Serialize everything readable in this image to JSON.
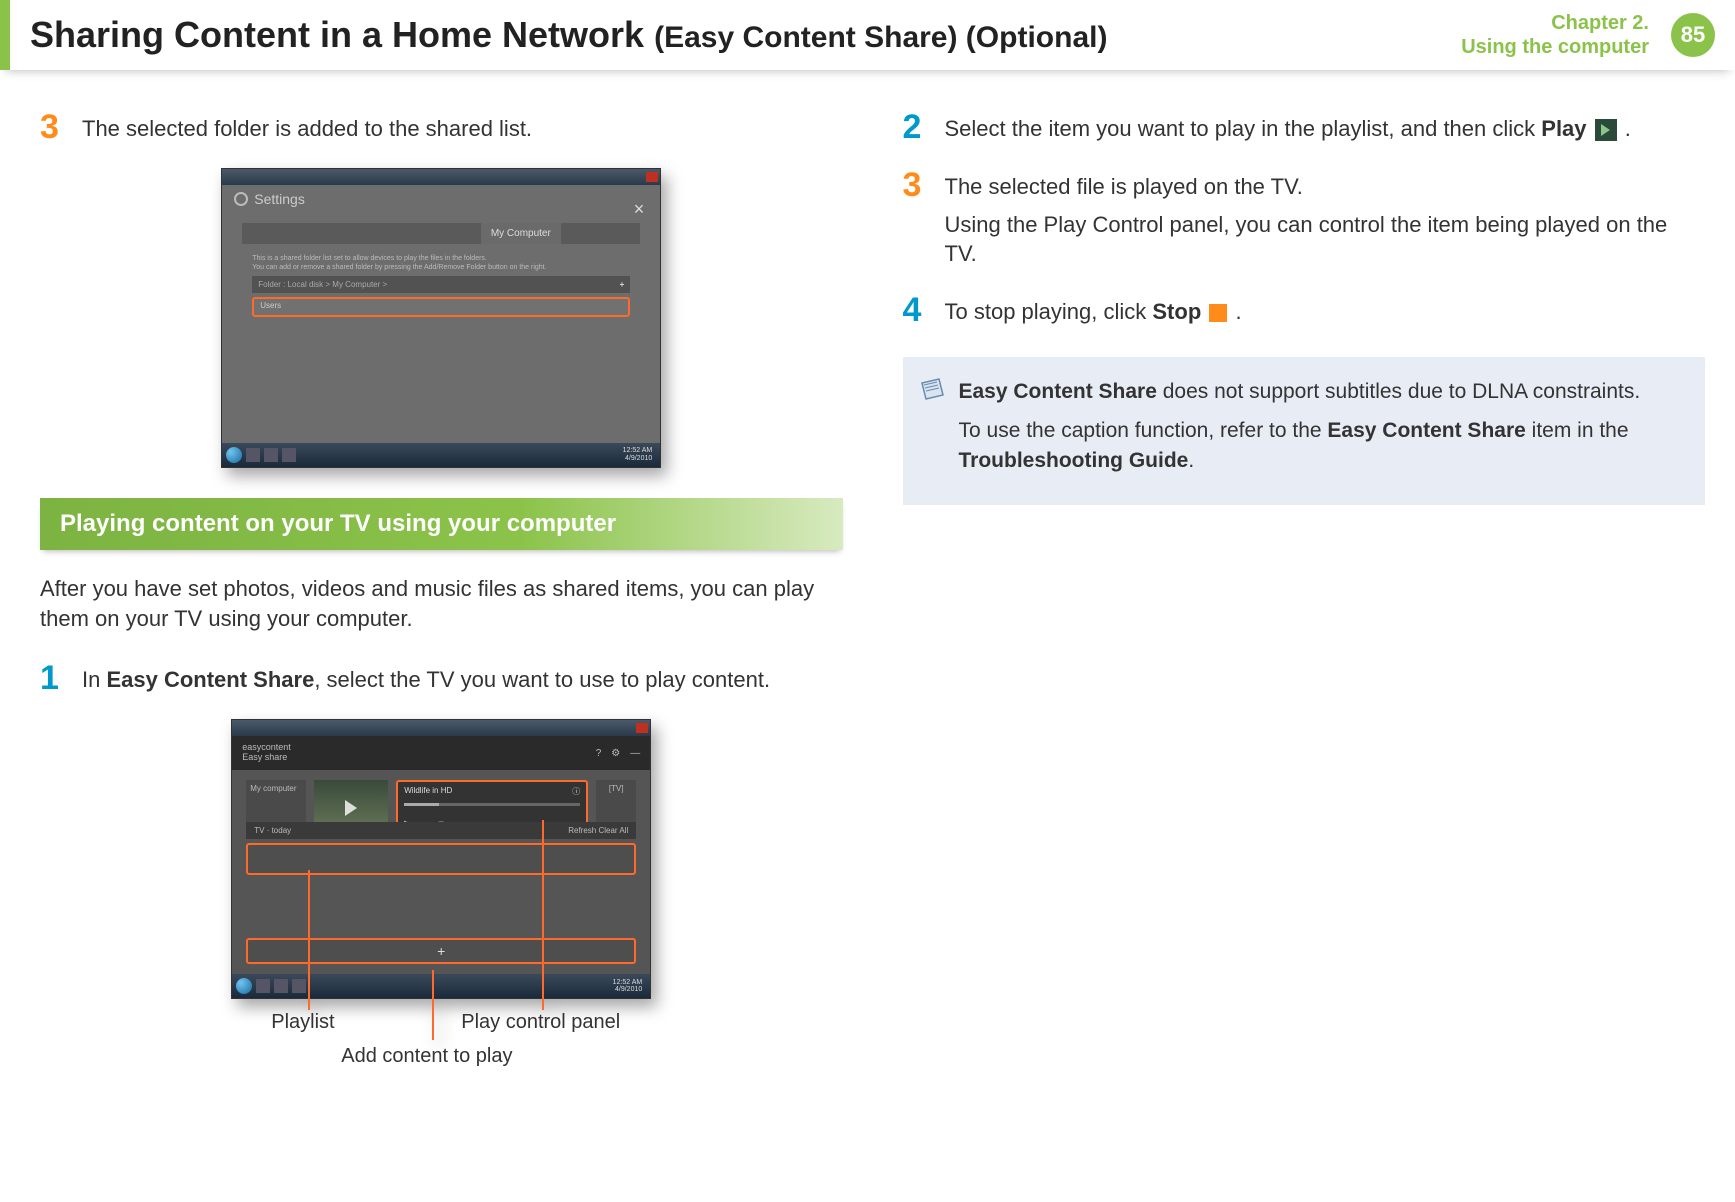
{
  "header": {
    "title_main": "Sharing Content in a Home Network",
    "title_sub": "(Easy Content Share) (Optional)",
    "chapter_line1": "Chapter 2.",
    "chapter_line2": "Using the computer",
    "page_number": "85"
  },
  "left_column": {
    "step3_text": "The selected folder is added to the shared list.",
    "screenshot1": {
      "settings_label": "Settings",
      "tabs": [
        "",
        "",
        "",
        "My Computer",
        ""
      ],
      "desc_line1": "This is a shared folder list set to allow devices to play the files in the folders.",
      "desc_line2": "You can add or remove a shared folder by pressing the Add/Remove Folder button on the right.",
      "pathbar": "Folder : Local disk > My Computer >",
      "row_label": "Users",
      "time": "12:52 AM",
      "date": "4/9/2010"
    },
    "section_title": "Playing content on your TV using your computer",
    "intro": "After you have set photos, videos and music files as shared items, you can play them on your TV using your computer.",
    "step1_prefix": "In ",
    "step1_bold": "Easy Content Share",
    "step1_suffix": ", select the TV you want to use to play content.",
    "screenshot2": {
      "logo_line1": "easycontent",
      "logo_line2": "Easy share",
      "left_label": "My computer",
      "player_title": "Wildlife in HD",
      "right_label": "[TV]",
      "row_left": "TV · today",
      "row_right": "Refresh  Clear All"
    },
    "callouts": {
      "playlist": "Playlist",
      "play_control": "Play control panel",
      "add_content": "Add content to play"
    }
  },
  "right_column": {
    "step2_prefix": "Select the item you want to play in the playlist, and then click ",
    "step2_play": "Play",
    "step2_suffix": " .",
    "step3_line1": "The selected file is played on the TV.",
    "step3_line2": "Using the Play Control panel, you can control the item being played on the TV.",
    "step4_prefix": "To stop playing, click ",
    "step4_stop": "Stop",
    "step4_suffix": " .",
    "note": {
      "bold1": "Easy Content Share",
      "text1": " does not support subtitles due to DLNA constraints.",
      "text2_prefix": "To use the caption function, refer to the ",
      "text2_bold1": "Easy Content Share",
      "text2_mid": " item in the ",
      "text2_bold2": "Troubleshooting Guide",
      "text2_suffix": "."
    }
  }
}
